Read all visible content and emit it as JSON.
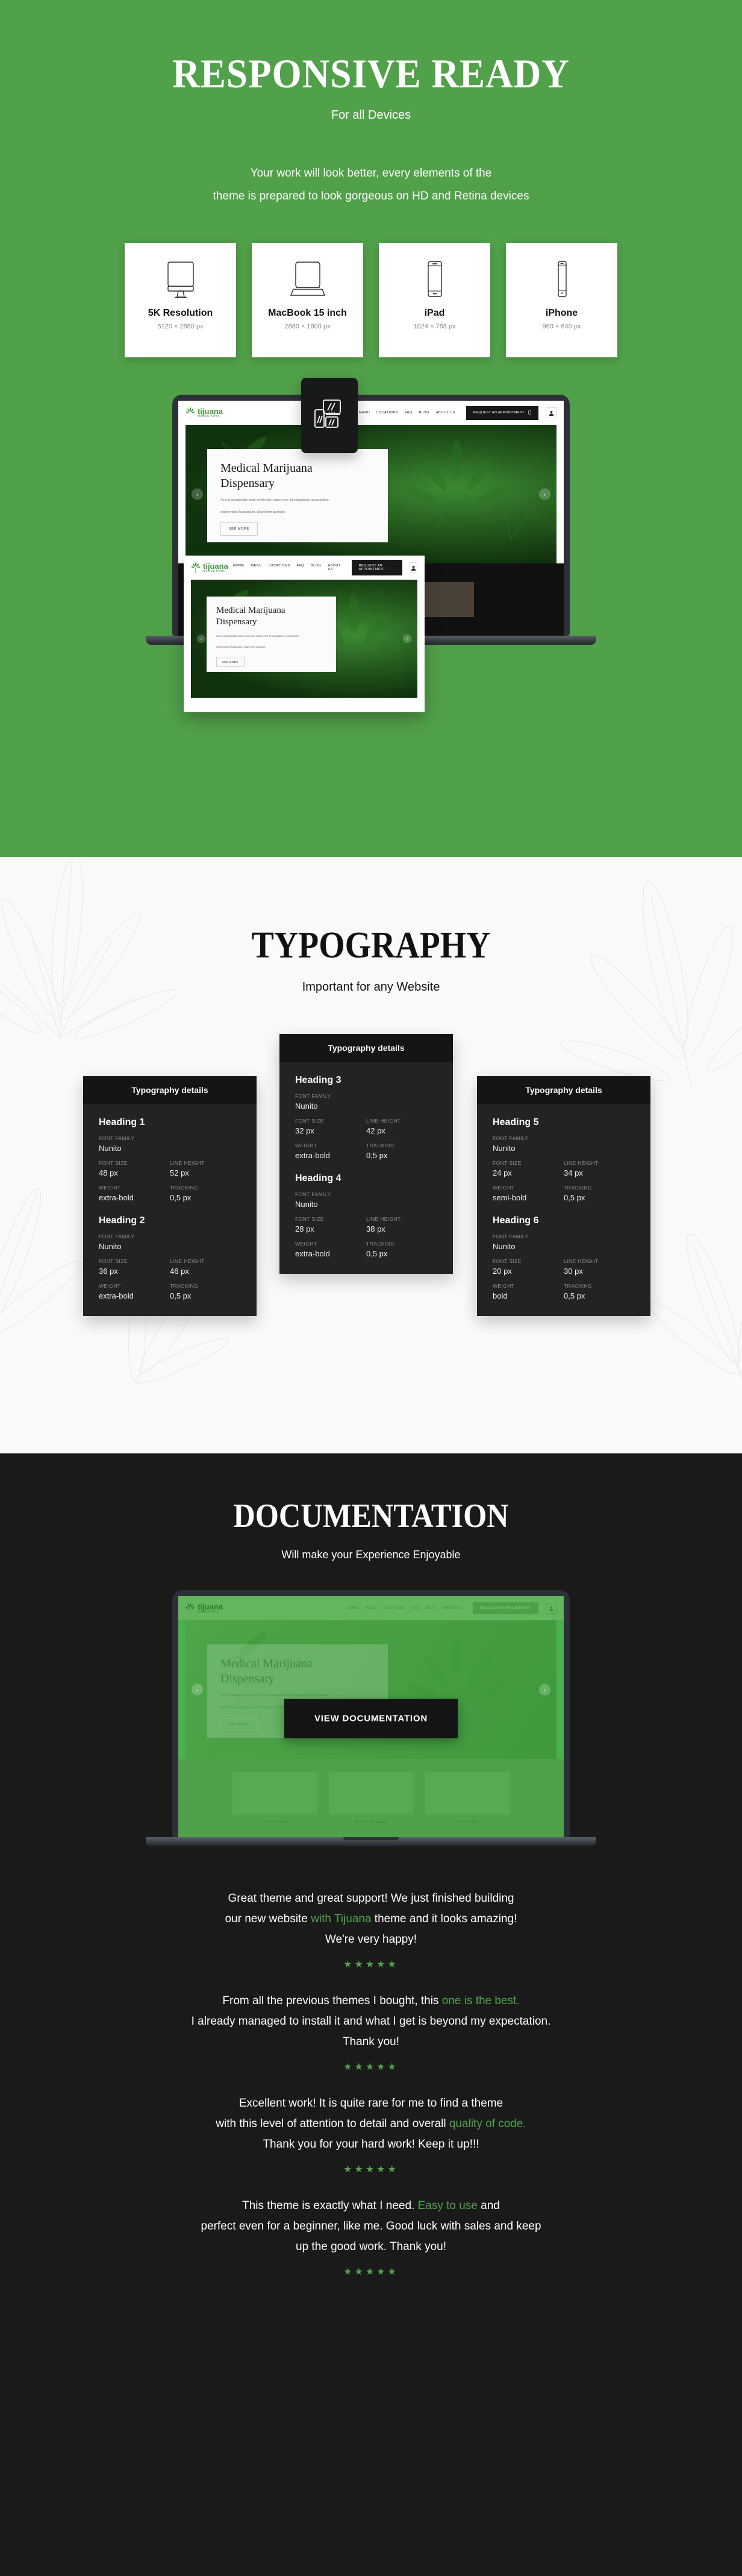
{
  "responsive": {
    "title": "RESPONSIVE READY",
    "subtitle": "For all Devices",
    "desc_line1": "Your work will look better, every elements of the",
    "desc_line2": "theme is prepared to look gorgeous on HD and Retina devices",
    "devices": [
      {
        "icon": "desktop-monitor-icon",
        "name": "5K Resolution",
        "resolution": "5120 × 2880 px"
      },
      {
        "icon": "laptop-icon",
        "name": "MacBook 15 inch",
        "resolution": "2880 × 1800 px"
      },
      {
        "icon": "tablet-icon",
        "name": "iPad",
        "resolution": "1024 × 768 px"
      },
      {
        "icon": "phone-icon",
        "name": "iPhone",
        "resolution": "960 × 640 px"
      }
    ]
  },
  "site_mockup": {
    "logo_name": "tijuana",
    "logo_sub": "medical herbs",
    "nav": [
      "HOME",
      "MENU",
      "LOCATIONS",
      "FAQ",
      "BLOG",
      "ABOUT US"
    ],
    "cta": "REQUEST AN APPOINTMENT",
    "hero_title_line1": "Medical Marijuana",
    "hero_title_line2": "Dispensary",
    "hero_text_line1": "Sed ut perspiciatis unde omnis iste natus error sit voluptatem accusantium",
    "hero_text_line2": "doloremque laudantium, totam rem aperiam.",
    "hero_button": "SEE MORE",
    "arrow_prev": "‹",
    "arrow_next": "›",
    "cards": [
      "Our Locations",
      "Browse our menus",
      "How to Qualify"
    ]
  },
  "typography": {
    "title": "TYPOGRAPHY",
    "subtitle": "Important for any Website",
    "card_header": "Typography details",
    "labels": {
      "font_family": "FONT FAMILY",
      "font_size": "FONT SIZE",
      "line_height": "LINE HEIGHT",
      "weight": "WEIGHT",
      "tracking": "TRACKING"
    },
    "cards": [
      {
        "entries": [
          {
            "heading": "Heading 1",
            "font_family": "Nunito",
            "font_size": "48 px",
            "line_height": "52 px",
            "weight": "extra-bold",
            "tracking": "0,5 px"
          },
          {
            "heading": "Heading 2",
            "font_family": "Nunito",
            "font_size": "36 px",
            "line_height": "46 px",
            "weight": "extra-bold",
            "tracking": "0,5 px"
          }
        ]
      },
      {
        "entries": [
          {
            "heading": "Heading 3",
            "font_family": "Nunito",
            "font_size": "32 px",
            "line_height": "42 px",
            "weight": "extra-bold",
            "tracking": "0,5 px"
          },
          {
            "heading": "Heading 4",
            "font_family": "Nunito",
            "font_size": "28 px",
            "line_height": "38 px",
            "weight": "extra-bold",
            "tracking": "0,5 px"
          }
        ]
      },
      {
        "entries": [
          {
            "heading": "Heading 5",
            "font_family": "Nunito",
            "font_size": "24 px",
            "line_height": "34 px",
            "weight": "semi-bold",
            "tracking": "0,5 px"
          },
          {
            "heading": "Heading 6",
            "font_family": "Nunito",
            "font_size": "20 px",
            "line_height": "30 px",
            "weight": "bold",
            "tracking": "0,5 px"
          }
        ]
      }
    ]
  },
  "documentation": {
    "title": "DOCUMENTATION",
    "subtitle": "Will make your Experience Enjoyable",
    "button": "VIEW DOCUMENTATION"
  },
  "testimonials": [
    {
      "lines": [
        [
          {
            "t": "Great theme and great support! We just finished building",
            "hl": false
          }
        ],
        [
          {
            "t": "our new website ",
            "hl": false
          },
          {
            "t": "with Tijuana",
            "hl": true
          },
          {
            "t": " theme and it looks amazing!",
            "hl": false
          }
        ],
        [
          {
            "t": "We're very happy!",
            "hl": false
          }
        ]
      ],
      "stars": "★★★★★"
    },
    {
      "lines": [
        [
          {
            "t": "From all the previous themes I bought, this ",
            "hl": false
          },
          {
            "t": "one is the best.",
            "hl": true
          }
        ],
        [
          {
            "t": "I already managed to install it and what I get is beyond my expectation.",
            "hl": false
          }
        ],
        [
          {
            "t": "Thank you!",
            "hl": false
          }
        ]
      ],
      "stars": "★★★★★"
    },
    {
      "lines": [
        [
          {
            "t": "Excellent work! It is quite rare for me to find a theme",
            "hl": false
          }
        ],
        [
          {
            "t": "with this level of attention to detail and overall ",
            "hl": false
          },
          {
            "t": "quality of code.",
            "hl": true
          }
        ],
        [
          {
            "t": "Thank you for your hard work! Keep it up!!!",
            "hl": false
          }
        ]
      ],
      "stars": "★★★★★"
    },
    {
      "lines": [
        [
          {
            "t": "This theme is exactly what I need. ",
            "hl": false
          },
          {
            "t": "Easy to use",
            "hl": true
          },
          {
            "t": " and",
            "hl": false
          }
        ],
        [
          {
            "t": "perfect even for a beginner, like me. Good luck with sales and keep",
            "hl": false
          }
        ],
        [
          {
            "t": "up the good work. Thank you!",
            "hl": false
          }
        ]
      ],
      "stars": "★★★★★"
    }
  ],
  "colors": {
    "brand_green": "#51a04a",
    "accent_green": "#52a34c",
    "dark": "#1a1a1a",
    "card_dark": "#232323",
    "card_header_dark": "#151515",
    "light_bg": "#fafafa"
  }
}
